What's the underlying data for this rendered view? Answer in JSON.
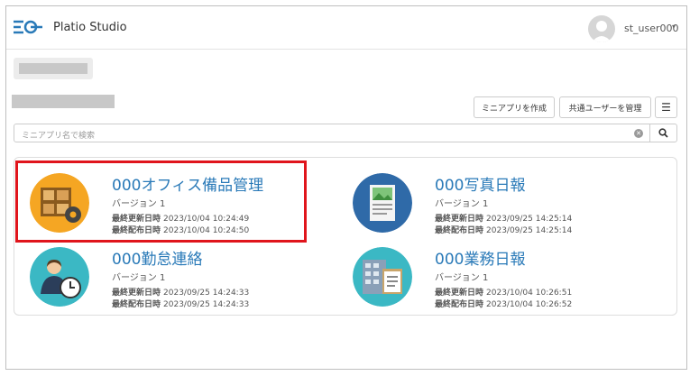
{
  "header": {
    "app_title": "Platio Studio",
    "user_name": "st_user000",
    "caret": "▾"
  },
  "toolbar": {
    "create_label": "ミニアプリを作成",
    "shared_users_label": "共通ユーザーを管理",
    "menu_glyph": "☰"
  },
  "search": {
    "placeholder": "ミニアプリ名で検索",
    "clear_glyph": "✕"
  },
  "apps": [
    {
      "title": "000オフィス備品管理",
      "version": "バージョン 1",
      "updated_label": "最終更新日時",
      "updated": "2023/10/04 10:24:49",
      "published_label": "最終配布日時",
      "published": "2023/10/04 10:24:50",
      "icon": "warehouse-gear-icon",
      "icon_color": "#f5a623",
      "highlighted": true
    },
    {
      "title": "000写真日報",
      "version": "バージョン 1",
      "updated_label": "最終更新日時",
      "updated": "2023/09/25 14:25:14",
      "published_label": "最終配布日時",
      "published": "2023/09/25 14:25:14",
      "icon": "photo-document-icon",
      "icon_color": "#2f6aa8"
    },
    {
      "title": "000勤怠連絡",
      "version": "バージョン 1",
      "updated_label": "最終更新日時",
      "updated": "2023/09/25 14:24:33",
      "published_label": "最終配布日時",
      "published": "2023/09/25 14:24:33",
      "icon": "person-clock-icon",
      "icon_color": "#3bb8c4"
    },
    {
      "title": "000業務日報",
      "version": "バージョン 1",
      "updated_label": "最終更新日時",
      "updated": "2023/10/04 10:26:51",
      "published_label": "最終配布日時",
      "published": "2023/10/04 10:26:52",
      "icon": "building-clipboard-icon",
      "icon_color": "#3bb8c4"
    }
  ],
  "colors": {
    "accent": "#2a7ab8",
    "highlight": "#e0151c"
  }
}
